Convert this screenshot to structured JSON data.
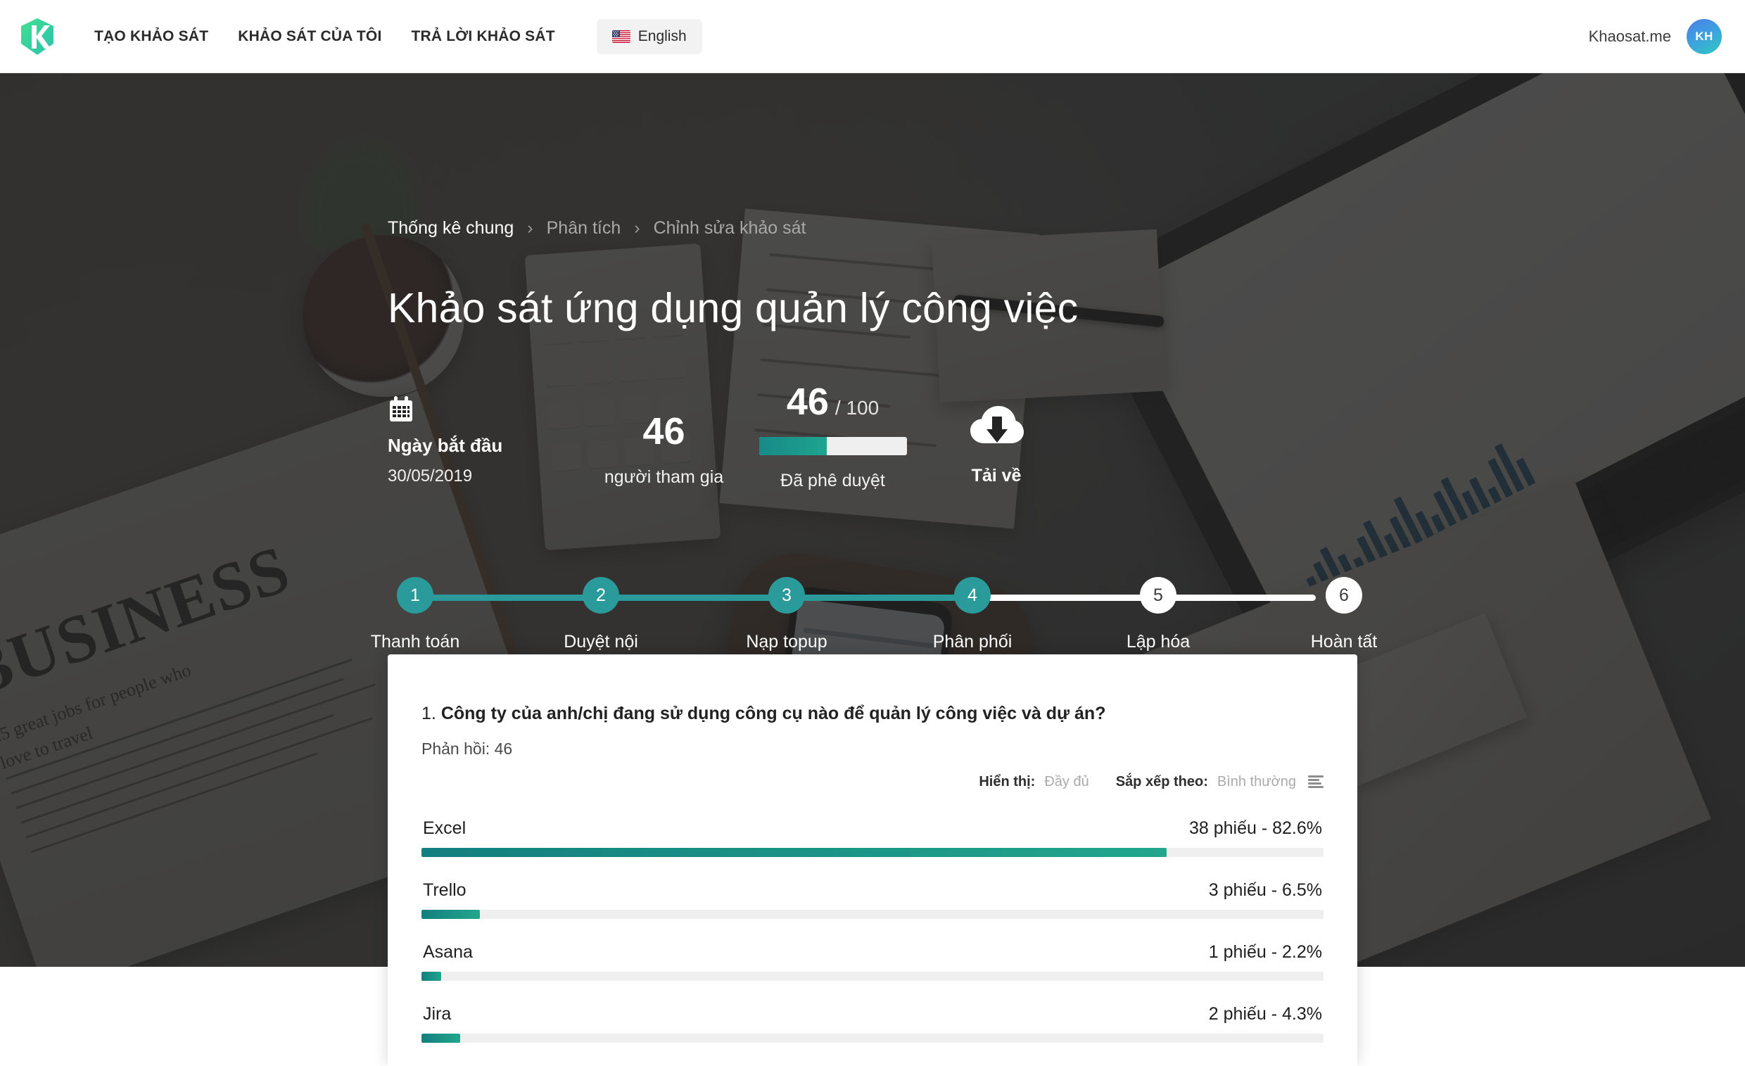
{
  "header": {
    "logo_icon": "khaosat-k-logo",
    "nav": [
      {
        "label": "TẠO KHẢO SÁT",
        "name": "nav-tao-khao-sat"
      },
      {
        "label": "KHẢO SÁT CỦA TÔI",
        "name": "nav-khao-sat-cua-toi"
      },
      {
        "label": "TRẢ LỜI KHẢO SÁT",
        "name": "nav-tra-loi-khao-sat"
      }
    ],
    "language": {
      "flag_icon": "us-flag-icon",
      "label": "English"
    },
    "account_name": "Khaosat.me",
    "avatar_initials": "KH"
  },
  "hero": {
    "breadcrumb": [
      {
        "label": "Thống kê chung",
        "active": true
      },
      {
        "label": "Phân tích",
        "active": false
      },
      {
        "label": "Chỉnh sửa khảo sát",
        "active": false
      }
    ],
    "breadcrumb_separator": "›",
    "title": "Khảo sát ứng dụng quản lý công việc",
    "stats": {
      "start": {
        "icon": "calendar-icon",
        "label": "Ngày bắt đầu",
        "value": "30/05/2019"
      },
      "participants": {
        "number": "46",
        "caption": "người tham gia"
      },
      "approved": {
        "number": "46",
        "denominator": "/ 100",
        "caption": "Đã phê duyệt",
        "percent": 46
      },
      "download": {
        "icon": "cloud-download-icon",
        "label": "Tải về"
      }
    },
    "steps": [
      {
        "num": "1",
        "label": "Thanh toán",
        "state": "done"
      },
      {
        "num": "2",
        "label": "Duyệt nội dung",
        "state": "done"
      },
      {
        "num": "3",
        "label": "Nạp topup trả thưởng",
        "state": "done"
      },
      {
        "num": "4",
        "label": "Phân phối khảo sát",
        "state": "done"
      },
      {
        "num": "5",
        "label": "Lập hóa đơn điện tử",
        "state": "todo"
      },
      {
        "num": "6",
        "label": "Hoàn tất",
        "state": "todo"
      }
    ]
  },
  "question_card": {
    "number": "1.",
    "text": "Công ty của anh/chị đang sử dụng công cụ nào để quản lý công việc và dự án?",
    "responses_label": "Phản hồi: 46",
    "display_label": "Hiển thị:",
    "display_value": "Đầy đủ",
    "sort_label": "Sắp xếp theo:",
    "sort_value": "Bình thường",
    "sort_icon": "sort-lines-icon"
  },
  "chart_data": {
    "type": "bar",
    "title": "1. Công ty của anh/chị đang sử dụng công cụ nào để quản lý công việc và dự án?",
    "orientation": "horizontal",
    "total_responses": 46,
    "unit_label": "phiếu",
    "categories": [
      "Excel",
      "Trello",
      "Asana",
      "Jira"
    ],
    "values": [
      38,
      3,
      1,
      2
    ],
    "percents": [
      82.6,
      6.5,
      2.2,
      4.3
    ],
    "labels": [
      "38 phiếu - 82.6%",
      "3 phiếu - 6.5%",
      "1 phiếu - 2.2%",
      "2 phiếu - 4.3%"
    ],
    "xlabel": "",
    "ylabel": "",
    "xlim": [
      0,
      100
    ],
    "grid": false,
    "legend": "none",
    "bar_color": "#1a9488"
  },
  "colors": {
    "accent_teal": "#2b9a9b",
    "bar_start": "#137f7f",
    "bar_end": "#22a68d",
    "hero_overlay": "#242424",
    "logo_green": "#3ddc97"
  }
}
